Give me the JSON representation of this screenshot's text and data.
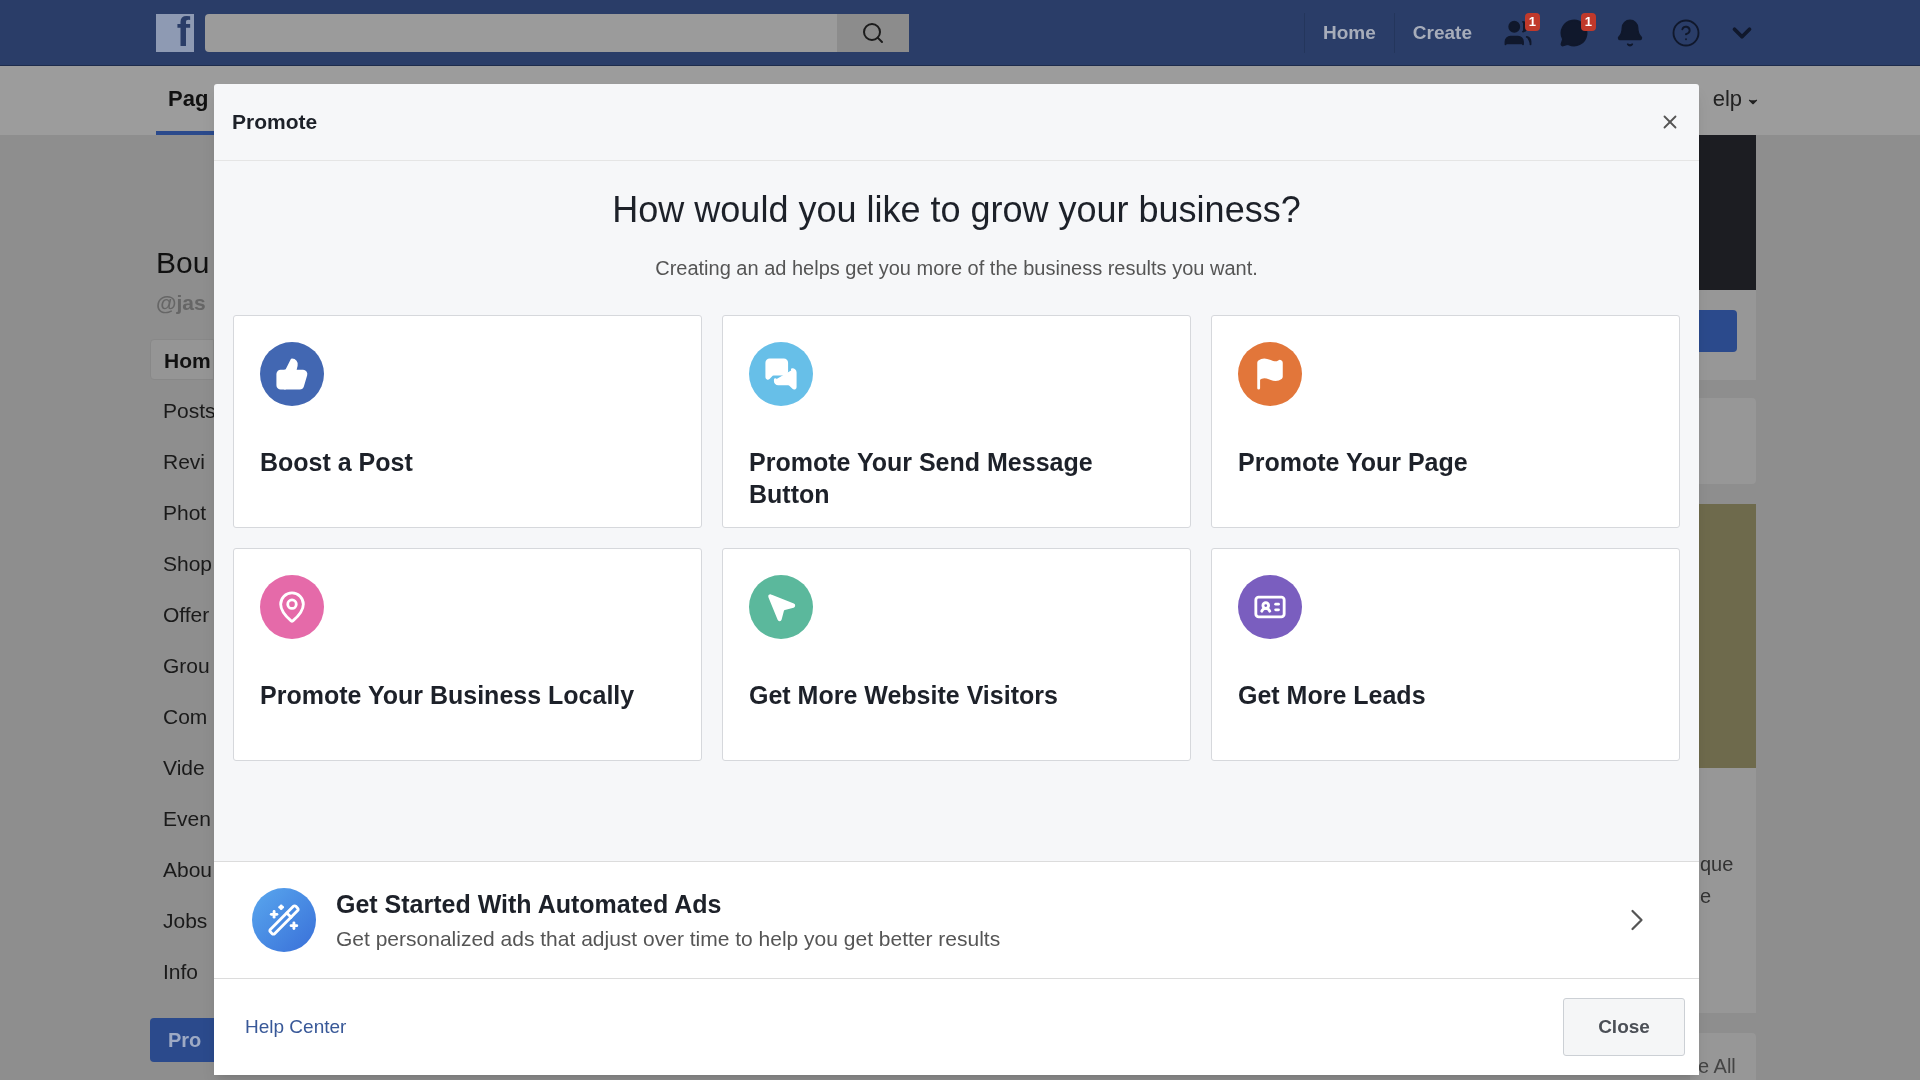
{
  "top_bar": {
    "logo": "f",
    "nav": [
      "Home",
      "Create"
    ],
    "icons": [
      {
        "kind": "friends",
        "badge": "1"
      },
      {
        "kind": "messages",
        "badge": "1"
      },
      {
        "kind": "notifications"
      },
      {
        "kind": "help"
      },
      {
        "kind": "menu"
      }
    ]
  },
  "page_tabs": [
    {
      "label": "Pag",
      "selected": true
    }
  ],
  "help_tab": "elp",
  "sidebar": {
    "title": "Bou",
    "handle": "@jas",
    "items": [
      {
        "label": "Hom",
        "selected": true
      },
      {
        "label": "Posts",
        "selected": false
      },
      {
        "label": "Revi",
        "selected": false
      },
      {
        "label": "Phot",
        "selected": false
      },
      {
        "label": "Shop",
        "selected": false
      },
      {
        "label": "Offer",
        "selected": false
      },
      {
        "label": "Grou",
        "selected": false
      },
      {
        "label": "Com",
        "selected": false
      },
      {
        "label": "Vide",
        "selected": false
      },
      {
        "label": "Even",
        "selected": false
      },
      {
        "label": "Abou",
        "selected": false
      },
      {
        "label": "Jobs",
        "selected": false
      },
      {
        "label": "Info",
        "selected": false
      }
    ],
    "button": "Pro"
  },
  "right_column": {
    "card_lines": [
      "que",
      "e"
    ],
    "see_all": "e All"
  },
  "modal": {
    "title": "Promote",
    "heading": "How would you like to grow your business?",
    "subtitle": "Creating an ad helps get you more of the business results you want.",
    "options": [
      {
        "kind": "like",
        "label": "Boost a Post",
        "color": "#4267b2"
      },
      {
        "kind": "message",
        "label": "Promote Your Send Message Button",
        "color": "#67bfe8"
      },
      {
        "kind": "flag",
        "label": "Promote Your Page",
        "color": "#e2763a"
      },
      {
        "kind": "pin",
        "label": "Promote Your Business Locally",
        "color": "#e56aa9"
      },
      {
        "kind": "cursor",
        "label": "Get More Website Visitors",
        "color": "#5bb89c"
      },
      {
        "kind": "leads",
        "label": "Get More Leads",
        "color": "#7a5ebf"
      }
    ],
    "automated": {
      "title": "Get Started With Automated Ads",
      "description": "Get personalized ads that adjust over time to help you get better results"
    },
    "help_link": "Help Center",
    "close_button": "Close"
  }
}
